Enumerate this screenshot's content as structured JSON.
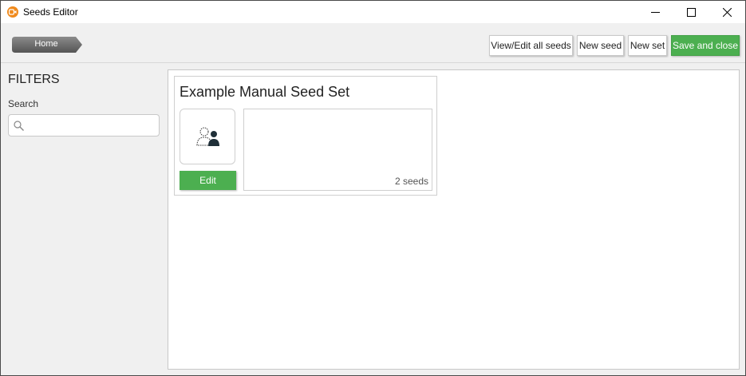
{
  "window": {
    "title": "Seeds Editor",
    "app_icon": "app-logo-icon",
    "controls": [
      "minimize-icon",
      "maximize-icon",
      "close-icon"
    ]
  },
  "toolbar": {
    "home_label": "Home",
    "view_edit_label": "View/Edit all seeds",
    "new_seed_label": "New seed",
    "new_set_label": "New set",
    "save_close_label": "Save and close"
  },
  "filters": {
    "title": "FILTERS",
    "search_label": "Search",
    "search_value": "",
    "search_placeholder": ""
  },
  "seed_sets": [
    {
      "title": "Example Manual Seed Set",
      "icon": "manual-seed-set-icon",
      "edit_label": "Edit",
      "seed_count": "2 seeds"
    }
  ],
  "colors": {
    "accent_green": "#4caf50",
    "app_icon_orange": "#f08a1c",
    "home_button_dark": "#6f6f6f"
  }
}
